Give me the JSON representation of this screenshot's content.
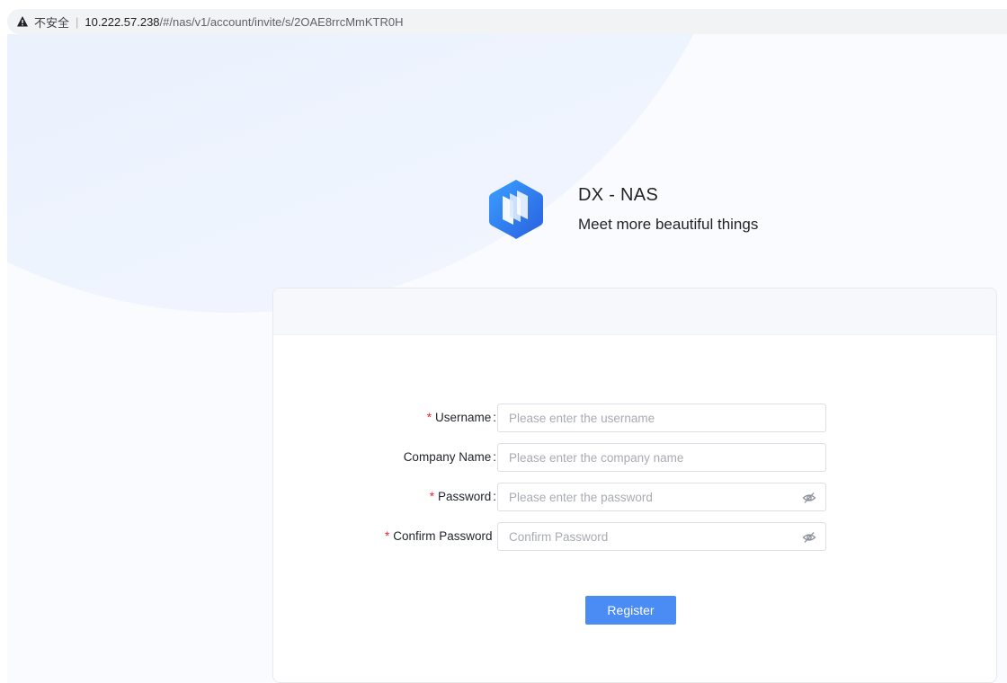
{
  "browser": {
    "security_label": "不安全",
    "separator": "|",
    "url_host": "10.222.57.238",
    "url_path": "/#/nas/v1/account/invite/s/2OAE8rrcMmKTR0H"
  },
  "brand": {
    "title": "DX - NAS",
    "slogan": "Meet more beautiful things",
    "logo_icon": "dx-nas-logo-icon"
  },
  "form": {
    "username": {
      "label": "Username",
      "required": true,
      "value": "",
      "placeholder": "Please enter the username"
    },
    "company_name": {
      "label": "Company Name",
      "required": false,
      "value": "",
      "placeholder": "Please enter the company name"
    },
    "password": {
      "label": "Password",
      "required": true,
      "value": "",
      "placeholder": "Please enter the password",
      "toggle_icon": "eye-hidden-icon"
    },
    "confirm_password": {
      "label": "Confirm Password",
      "required": true,
      "value": "",
      "placeholder": "Confirm Password",
      "toggle_icon": "eye-hidden-icon"
    },
    "register_label": "Register"
  },
  "colors": {
    "primary": "#4a8cf3",
    "required_mark": "#f5222d",
    "background_blob": "#e6eefc"
  }
}
